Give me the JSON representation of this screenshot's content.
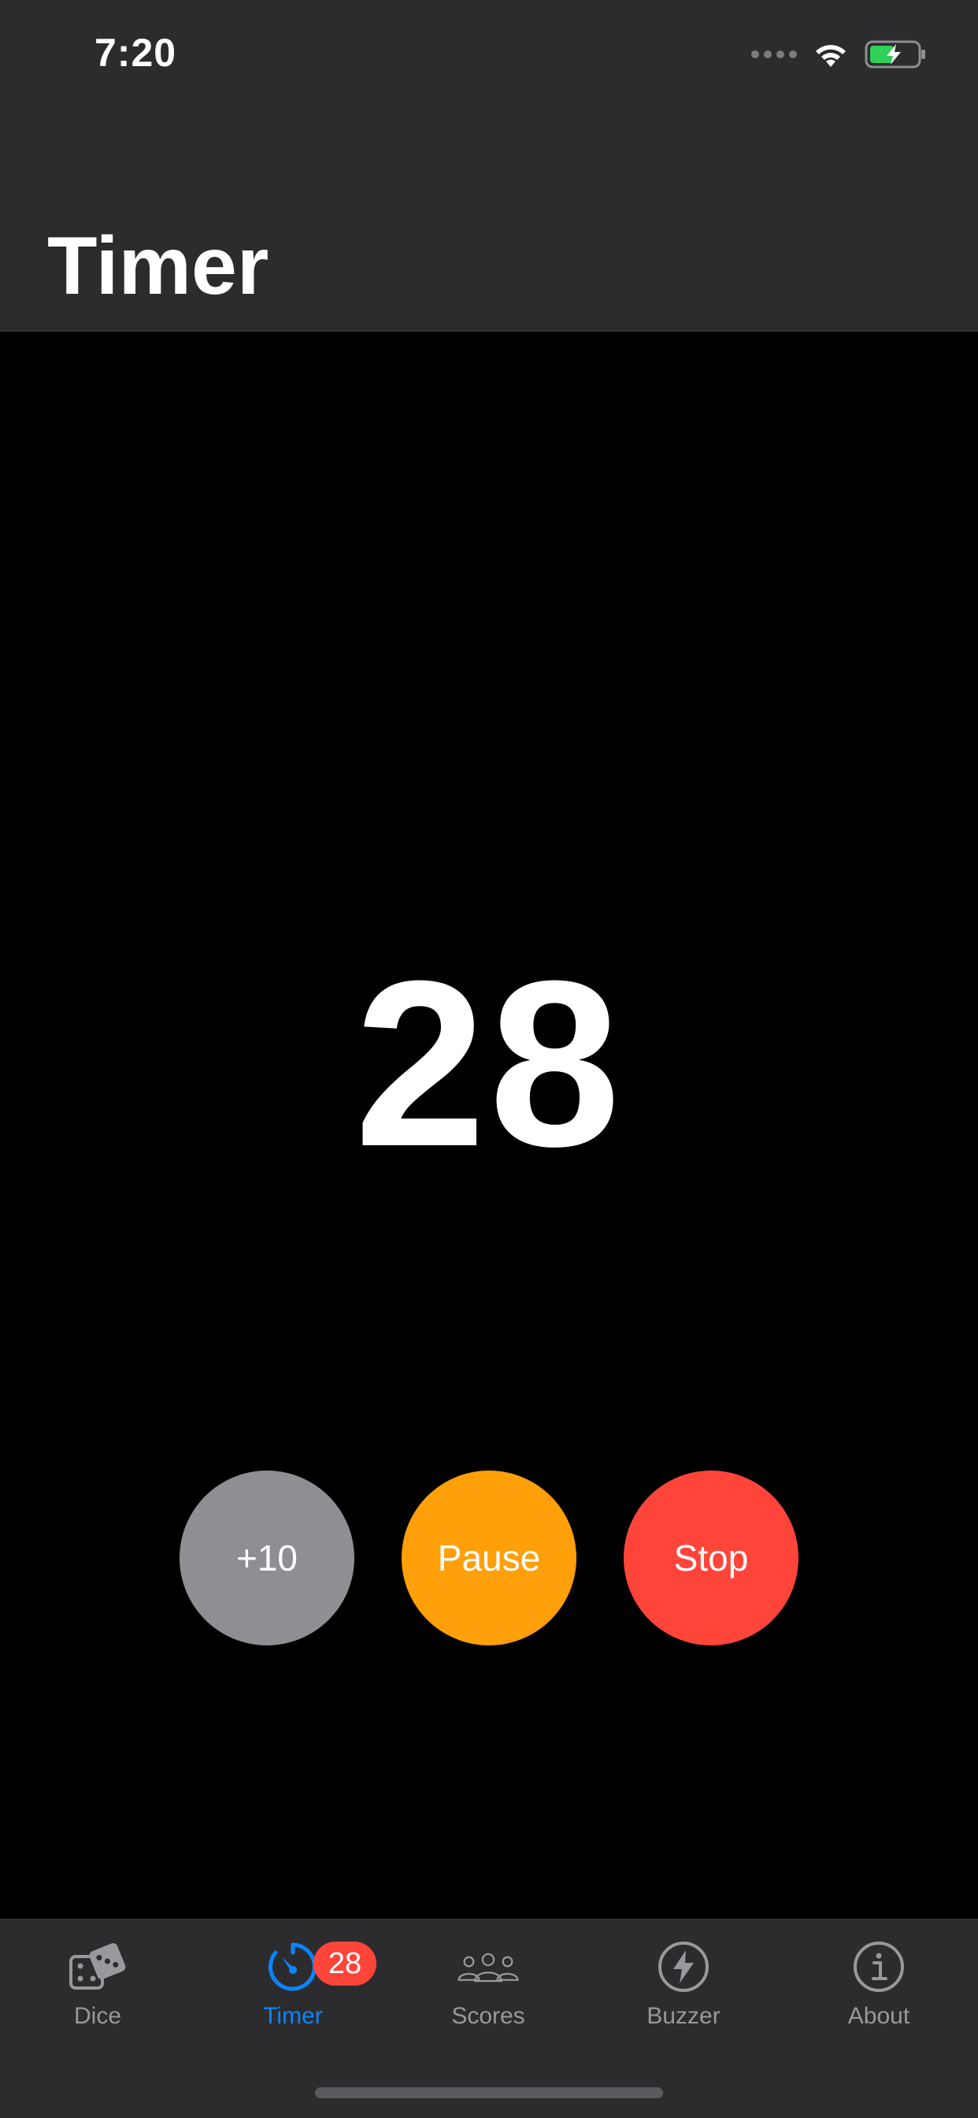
{
  "status_bar": {
    "time": "7:20"
  },
  "header": {
    "title": "Timer"
  },
  "timer": {
    "value": "28"
  },
  "controls": {
    "add_label": "+10",
    "pause_label": "Pause",
    "stop_label": "Stop"
  },
  "tabs": [
    {
      "label": "Dice",
      "icon": "dice-icon",
      "active": false
    },
    {
      "label": "Timer",
      "icon": "timer-icon",
      "active": true,
      "badge": "28"
    },
    {
      "label": "Scores",
      "icon": "people-icon",
      "active": false
    },
    {
      "label": "Buzzer",
      "icon": "lightning-icon",
      "active": false
    },
    {
      "label": "About",
      "icon": "info-icon",
      "active": false
    }
  ],
  "colors": {
    "accent": "#0a84ff",
    "add": "#8e8e93",
    "pause": "#ff9f0a",
    "stop": "#ff453a",
    "battery_fill": "#30d158"
  }
}
